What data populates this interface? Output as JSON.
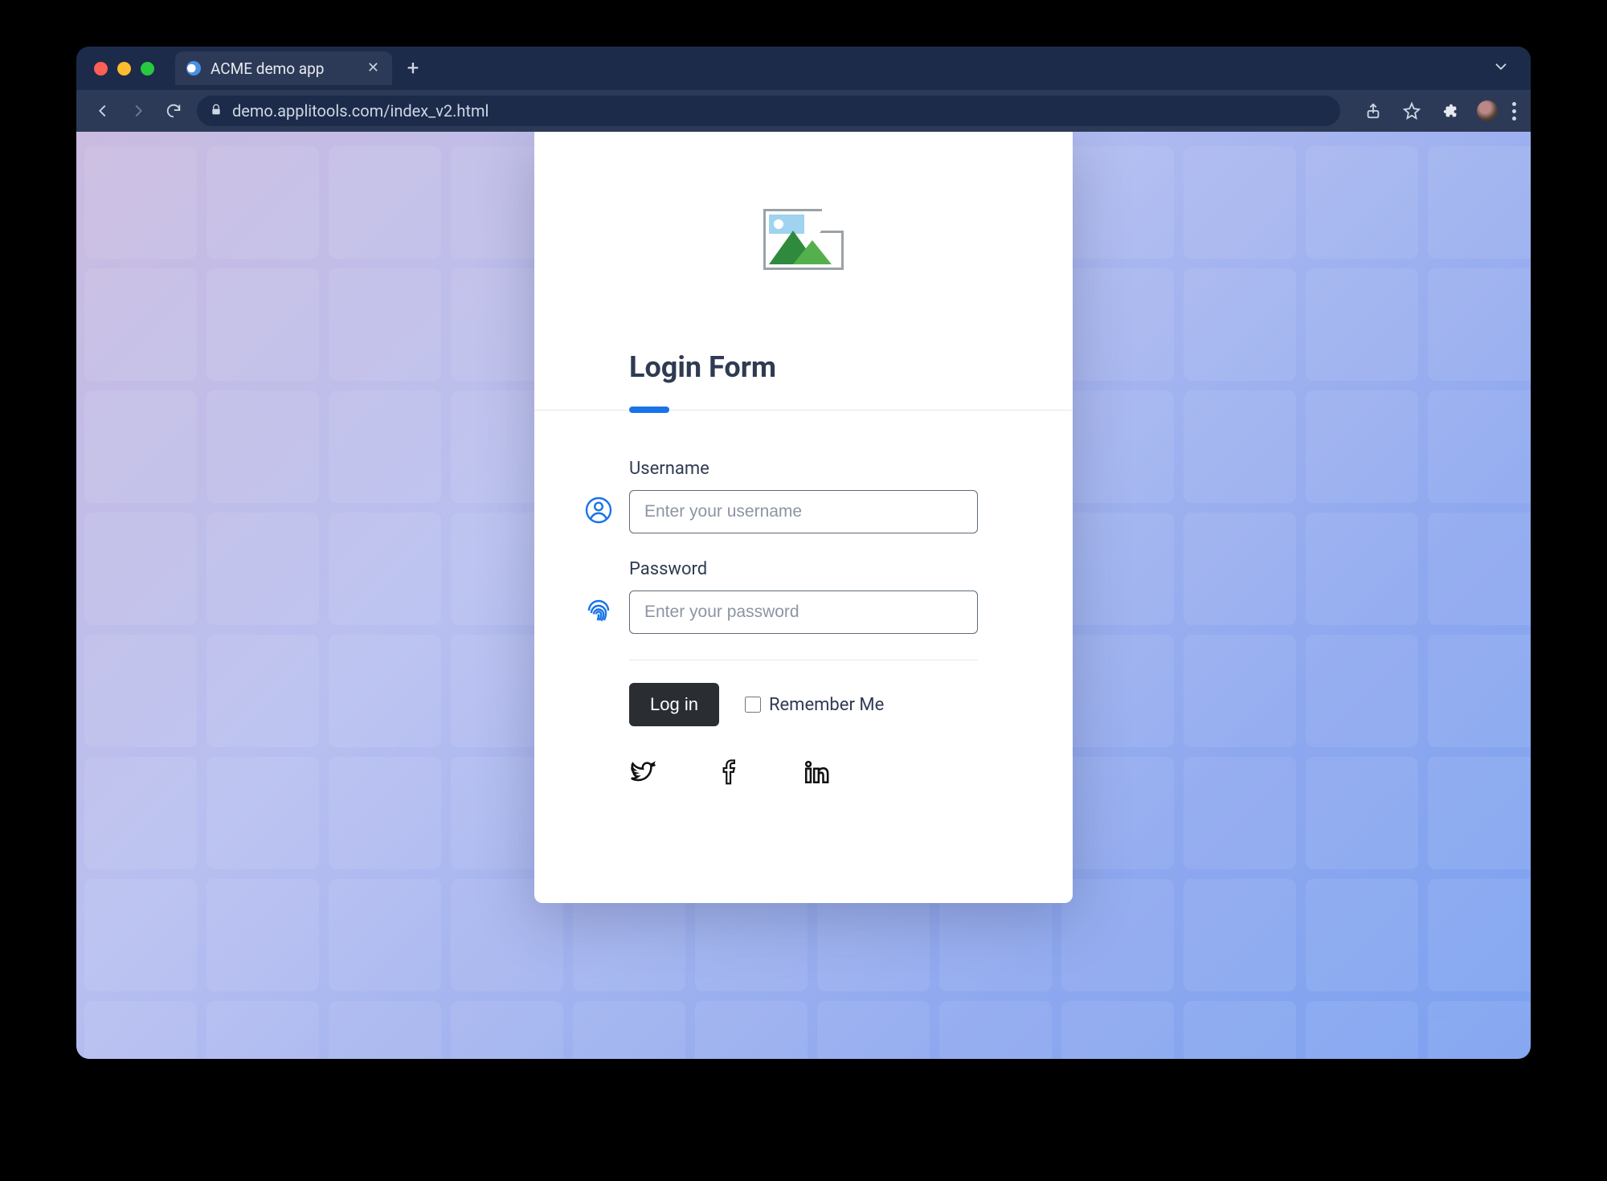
{
  "browser": {
    "tab_title": "ACME demo app",
    "url": "demo.applitools.com/index_v2.html"
  },
  "form": {
    "title": "Login Form",
    "username": {
      "label": "Username",
      "placeholder": "Enter your username",
      "value": ""
    },
    "password": {
      "label": "Password",
      "placeholder": "Enter your password",
      "value": ""
    },
    "login_button": "Log in",
    "remember_label": "Remember Me",
    "remember_checked": false
  },
  "social": {
    "twitter": "twitter",
    "facebook": "facebook",
    "linkedin": "linkedin"
  }
}
